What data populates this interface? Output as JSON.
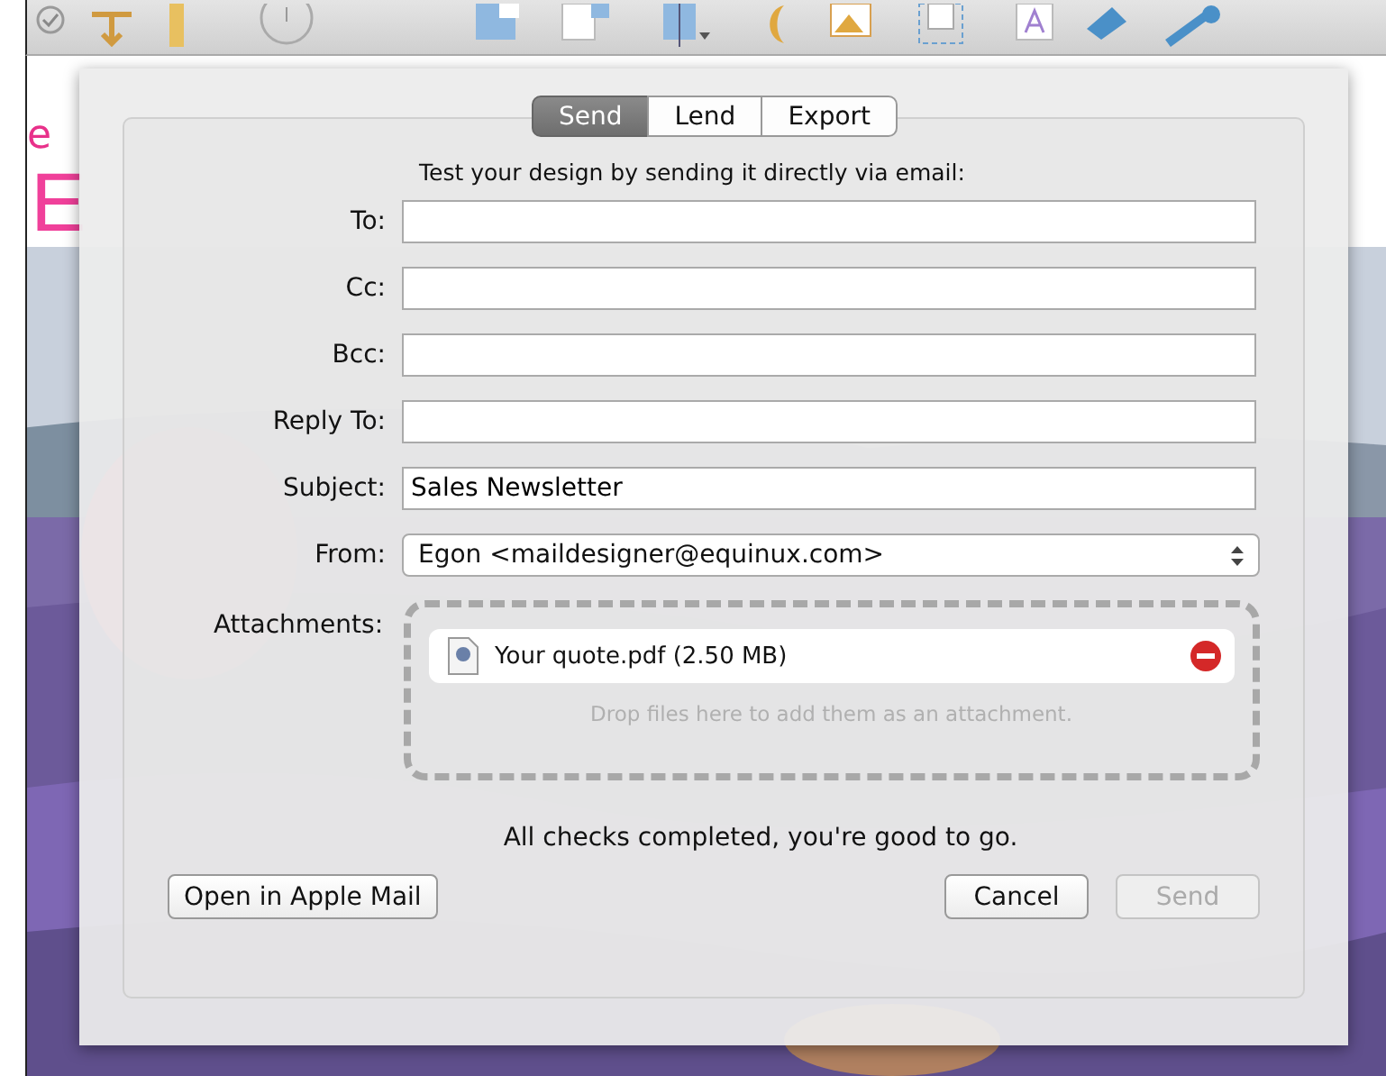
{
  "design_text": [
    "e",
    "E"
  ],
  "sheet": {
    "tabs": [
      {
        "label": "Send",
        "selected": true
      },
      {
        "label": "Lend",
        "selected": false
      },
      {
        "label": "Export",
        "selected": false
      }
    ],
    "intro": "Test your design by sending it directly via email:",
    "fields": [
      {
        "label": "To:",
        "kind": "text"
      },
      {
        "label": "Cc:",
        "kind": "text"
      },
      {
        "label": "Bcc:",
        "kind": "text"
      },
      {
        "label": "Reply To:",
        "kind": "text"
      },
      {
        "label": "Subject:",
        "value": "Sales Newsletter",
        "kind": "text"
      },
      {
        "label": "From:",
        "value": "Egon <maildesigner@equinux.com>",
        "kind": "popup"
      }
    ],
    "attachments": {
      "label": "Attachments:",
      "files": [
        {
          "name": "Your quote.pdf (2.50 MB)"
        }
      ],
      "hint": "Drop files here to add them as an attachment."
    },
    "status": "All checks completed, you're good to go.",
    "left_buttons": [
      {
        "label": "Open in Apple Mail",
        "disabled": false
      }
    ],
    "right_buttons": [
      {
        "label": "Cancel",
        "disabled": false
      },
      {
        "label": "Send",
        "disabled": true
      }
    ]
  }
}
